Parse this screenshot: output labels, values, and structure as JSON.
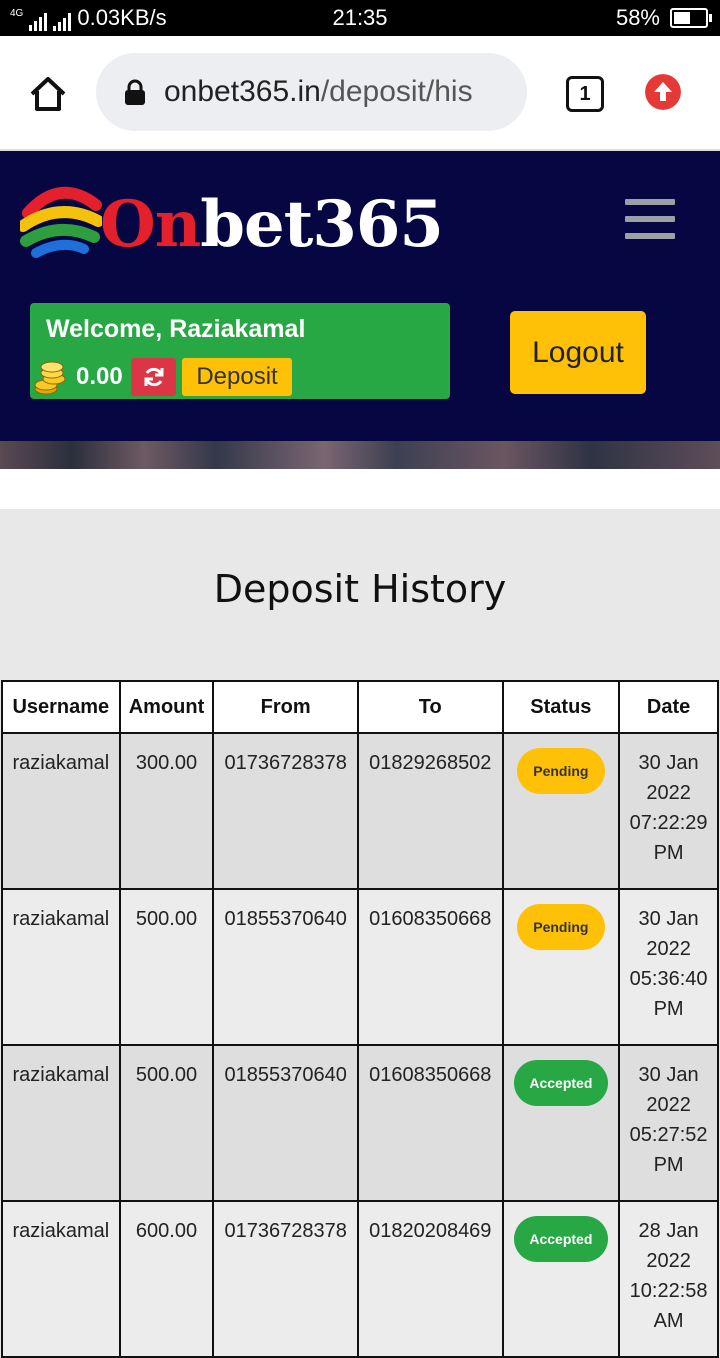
{
  "status_bar": {
    "network": "4G",
    "speed": "0.03KB/s",
    "time": "21:35",
    "battery": "58%",
    "battery_level": 0.58
  },
  "browser": {
    "url_domain": "onbet365.in",
    "url_path": "/deposit/his",
    "tab_count": "1"
  },
  "header": {
    "logo_first": "On",
    "logo_rest": "bet365",
    "welcome": "Welcome, Raziakamal",
    "balance": "0.00",
    "deposit_label": "Deposit",
    "logout_label": "Logout"
  },
  "main": {
    "title": "Deposit History",
    "columns": [
      "Username",
      "Amount",
      "From",
      "To",
      "Status",
      "Date"
    ],
    "rows": [
      {
        "username": "raziakamal",
        "amount": "300.00",
        "from": "01736728378",
        "to": "01829268502",
        "status": "Pending",
        "date_day": "30 Jan",
        "date_year": "2022",
        "date_time": "07:22:29",
        "date_ampm": "PM"
      },
      {
        "username": "raziakamal",
        "amount": "500.00",
        "from": "01855370640",
        "to": "01608350668",
        "status": "Pending",
        "date_day": "30 Jan",
        "date_year": "2022",
        "date_time": "05:36:40",
        "date_ampm": "PM"
      },
      {
        "username": "raziakamal",
        "amount": "500.00",
        "from": "01855370640",
        "to": "01608350668",
        "status": "Accepted",
        "date_day": "30 Jan",
        "date_year": "2022",
        "date_time": "05:27:52",
        "date_ampm": "PM"
      },
      {
        "username": "raziakamal",
        "amount": "600.00",
        "from": "01736728378",
        "to": "01820208469",
        "status": "Accepted",
        "date_day": "28 Jan",
        "date_year": "2022",
        "date_time": "10:22:58",
        "date_ampm": "AM"
      }
    ]
  },
  "colors": {
    "header_bg": "#060742",
    "success": "#28a745",
    "warning": "#ffc107",
    "danger": "#dc3545"
  }
}
